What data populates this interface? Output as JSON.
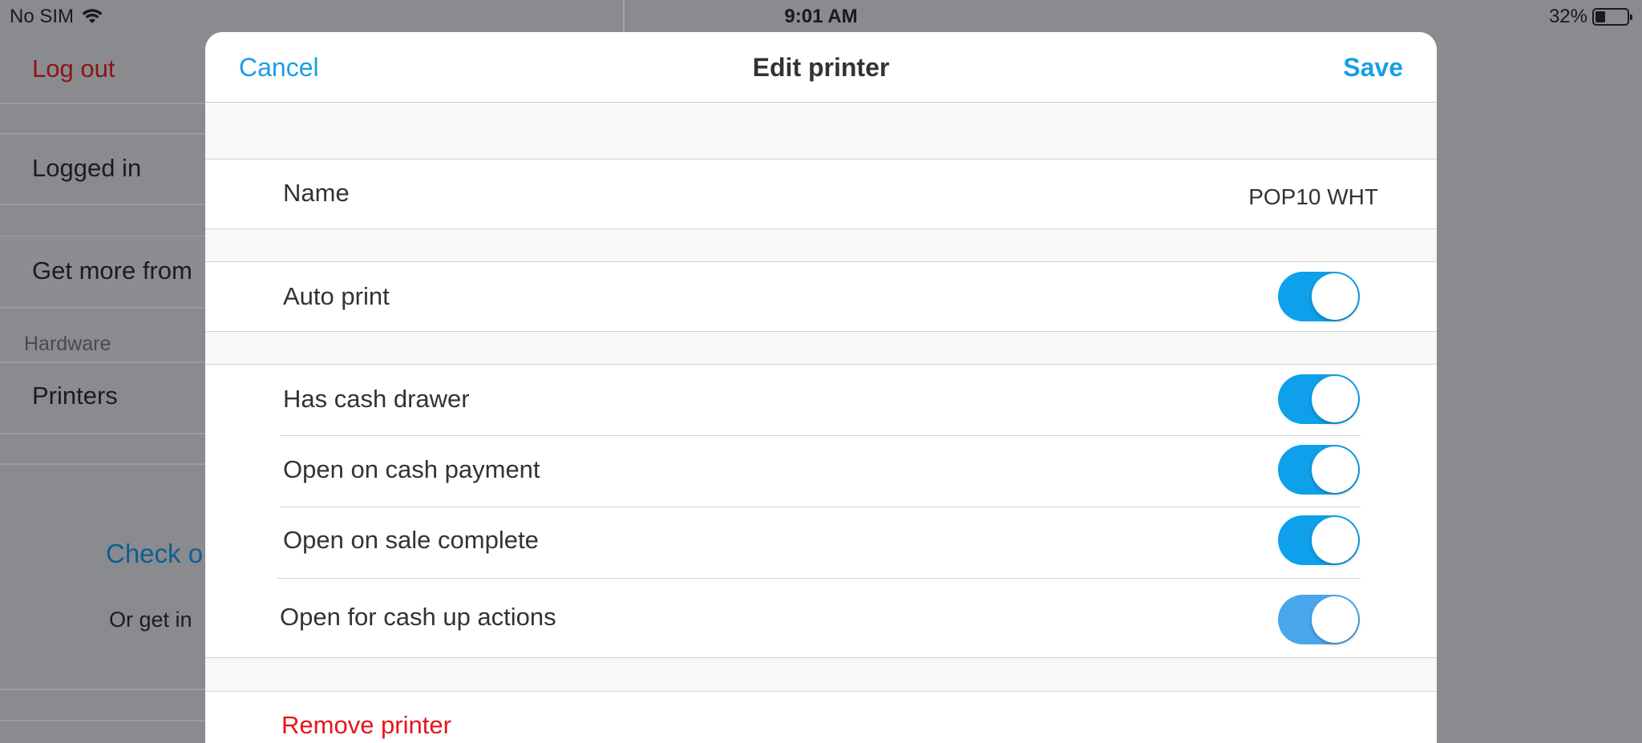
{
  "status_bar": {
    "carrier": "No SIM",
    "time": "9:01 AM",
    "battery": "32%"
  },
  "background": {
    "logout": "Log out",
    "logged_in": "Logged in",
    "get_more": "Get more from",
    "section_hardware": "Hardware",
    "printers": "Printers",
    "check_link": "Check o",
    "get_in": "Or get in"
  },
  "modal": {
    "cancel": "Cancel",
    "title": "Edit printer",
    "save": "Save",
    "name_label": "Name",
    "name_value": "POP10 WHT",
    "auto_print": "Auto print",
    "has_cash_drawer": "Has cash drawer",
    "open_on_cash_payment": "Open on cash payment",
    "open_on_sale_complete": "Open on sale complete",
    "open_for_cash_up": "Open for cash up actions",
    "remove": "Remove printer"
  },
  "toggles": {
    "auto_print": true,
    "has_cash_drawer": true,
    "open_on_cash_payment": true,
    "open_on_sale_complete": true,
    "open_for_cash_up": true
  },
  "colors": {
    "accent": "#1a9ee6",
    "toggle_on": "#0ea0ea",
    "destructive": "#e8141b",
    "logout": "#8c1414"
  }
}
